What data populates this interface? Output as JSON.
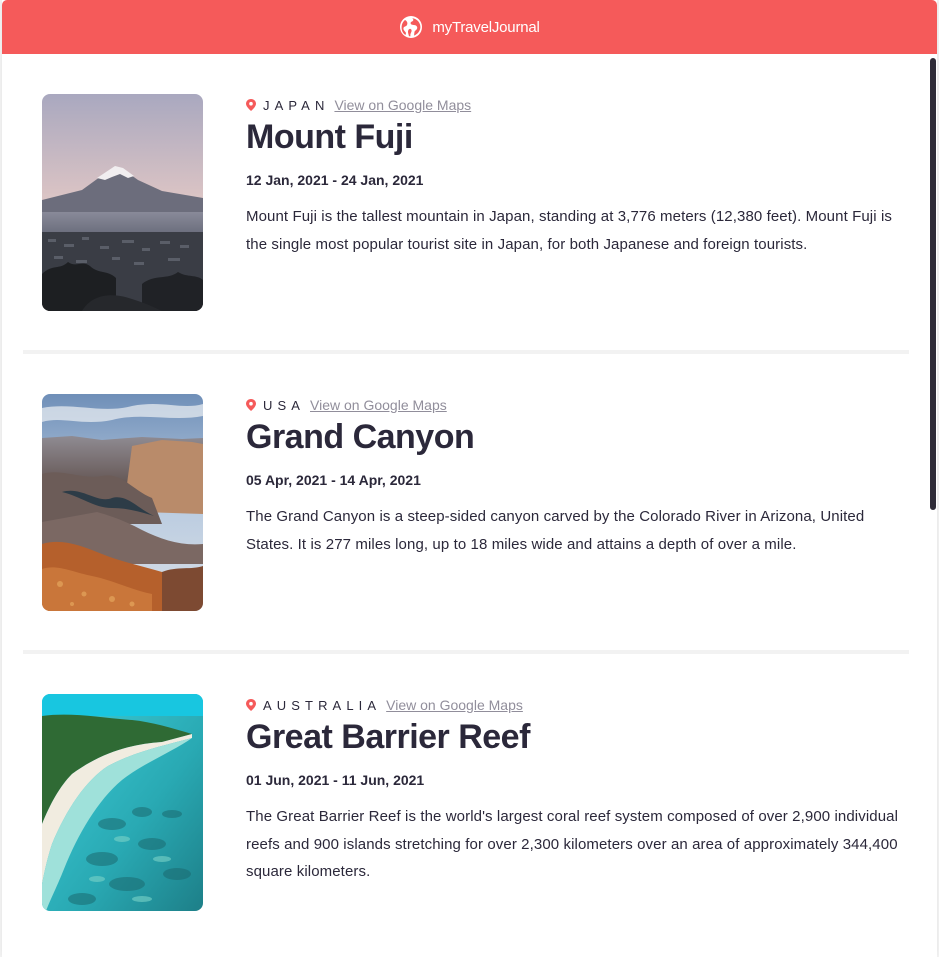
{
  "header": {
    "brand": "myTravelJournal",
    "icon": "globe-icon",
    "background": "#f55a5a"
  },
  "entries": [
    {
      "location": "Japan",
      "maps_link": "View on Google Maps",
      "title": "Mount Fuji",
      "dates": "12 Jan, 2021 - 24 Jan, 2021",
      "description": "Mount Fuji is the tallest mountain in Japan, standing at 3,776 meters (12,380 feet). Mount Fuji is the single most popular tourist site in Japan, for both Japanese and foreign tourists."
    },
    {
      "location": "USA",
      "maps_link": "View on Google Maps",
      "title": "Grand Canyon",
      "dates": "05 Apr, 2021 - 14 Apr, 2021",
      "description": "The Grand Canyon is a steep-sided canyon carved by the Colorado River in Arizona, United States. It is 277 miles long, up to 18 miles wide and attains a depth of over a mile."
    },
    {
      "location": "Australia",
      "maps_link": "View on Google Maps",
      "title": "Great Barrier Reef",
      "dates": "01 Jun, 2021 - 11 Jun, 2021",
      "description": "The Great Barrier Reef is the world's largest coral reef system composed of over 2,900 individual reefs and 900 islands stretching for over 2,300 kilometers over an area of approximately 344,400 square kilometers."
    }
  ],
  "colors": {
    "accent": "#f55a5a",
    "text": "#2b283a",
    "link": "#918e9b"
  }
}
